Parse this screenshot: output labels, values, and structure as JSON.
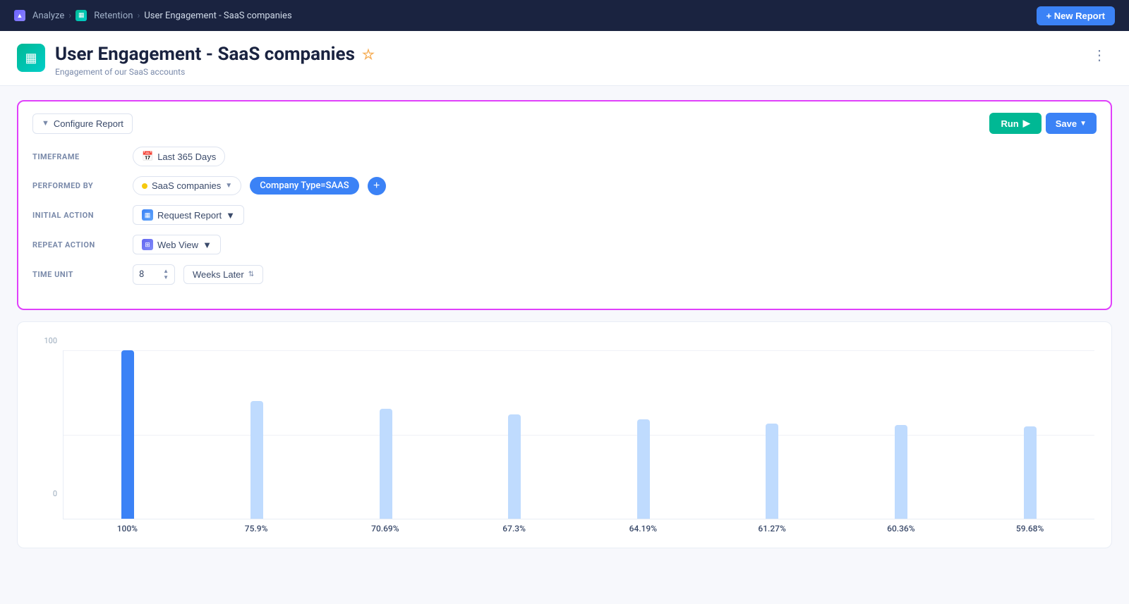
{
  "nav": {
    "new_report_label": "+ New Report",
    "breadcrumb": [
      {
        "label": "Analyze",
        "icon": "analyze"
      },
      {
        "label": "Retention",
        "icon": "retention"
      },
      {
        "label": "User Engagement - SaaS companies",
        "icon": null
      }
    ]
  },
  "page": {
    "title": "User Engagement - SaaS companies",
    "subtitle": "Engagement of our SaaS accounts",
    "star": "☆",
    "more": "⋮"
  },
  "config": {
    "configure_label": "Configure Report",
    "run_label": "Run",
    "save_label": "Save",
    "timeframe_label": "TIMEFRAME",
    "timeframe_value": "Last 365 Days",
    "performed_by_label": "PERFORMED BY",
    "performed_by_filter": "SaaS companies",
    "performed_by_tag": "Company Type=SAAS",
    "initial_action_label": "INITIAL ACTION",
    "initial_action_value": "Request Report",
    "repeat_action_label": "REPEAT ACTION",
    "repeat_action_value": "Web View",
    "time_unit_label": "TIME UNIT",
    "time_unit_value": "8",
    "time_unit_period": "Weeks Later"
  },
  "chart": {
    "y_labels": [
      "100",
      "0"
    ],
    "bars": [
      {
        "label": "100%",
        "height_pct": 100,
        "type": "blue"
      },
      {
        "label": "75.9%",
        "height_pct": 75.9,
        "type": "light"
      },
      {
        "label": "70.69%",
        "height_pct": 70.69,
        "type": "light"
      },
      {
        "label": "67.3%",
        "height_pct": 67.3,
        "type": "light"
      },
      {
        "label": "64.19%",
        "height_pct": 64.19,
        "type": "light"
      },
      {
        "label": "61.27%",
        "height_pct": 61.27,
        "type": "light"
      },
      {
        "label": "60.36%",
        "height_pct": 60.36,
        "type": "light"
      },
      {
        "label": "59.68%",
        "height_pct": 59.68,
        "type": "light"
      }
    ]
  }
}
